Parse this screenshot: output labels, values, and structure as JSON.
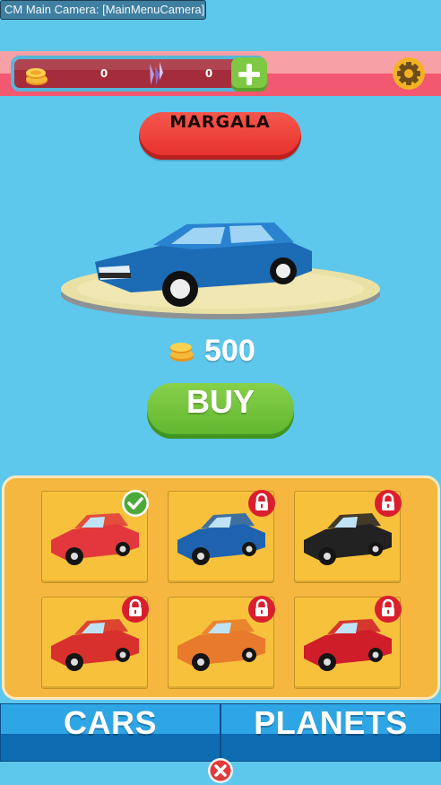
{
  "debug": {
    "camera_label": "CM Main Camera: [MainMenuCamera]"
  },
  "currency": {
    "coins": "0",
    "gems": "0",
    "coin_icon": "coins-icon",
    "gem_icon": "crystal-icon"
  },
  "header": {
    "add_icon": "plus-icon",
    "settings_icon": "gear-icon"
  },
  "showcase": {
    "car_name": "MARGALA",
    "price": "500",
    "buy_label": "BUY"
  },
  "garage": {
    "cars": [
      {
        "color": "#e2383d",
        "status": "owned"
      },
      {
        "color": "#1f63b0",
        "status": "locked"
      },
      {
        "color": "#222222",
        "status": "locked"
      },
      {
        "color": "#d8302c",
        "status": "locked"
      },
      {
        "color": "#e87a2c",
        "status": "locked"
      },
      {
        "color": "#cf1d2a",
        "status": "locked"
      }
    ]
  },
  "tabs": {
    "cars": "CARS",
    "planets": "PLANETS"
  },
  "colors": {
    "sky": "#5ec7ec",
    "accent_red": "#e52f2a",
    "accent_green": "#5db52d",
    "panel_orange": "#f6b741",
    "tab_blue": "#0d6cb2"
  }
}
